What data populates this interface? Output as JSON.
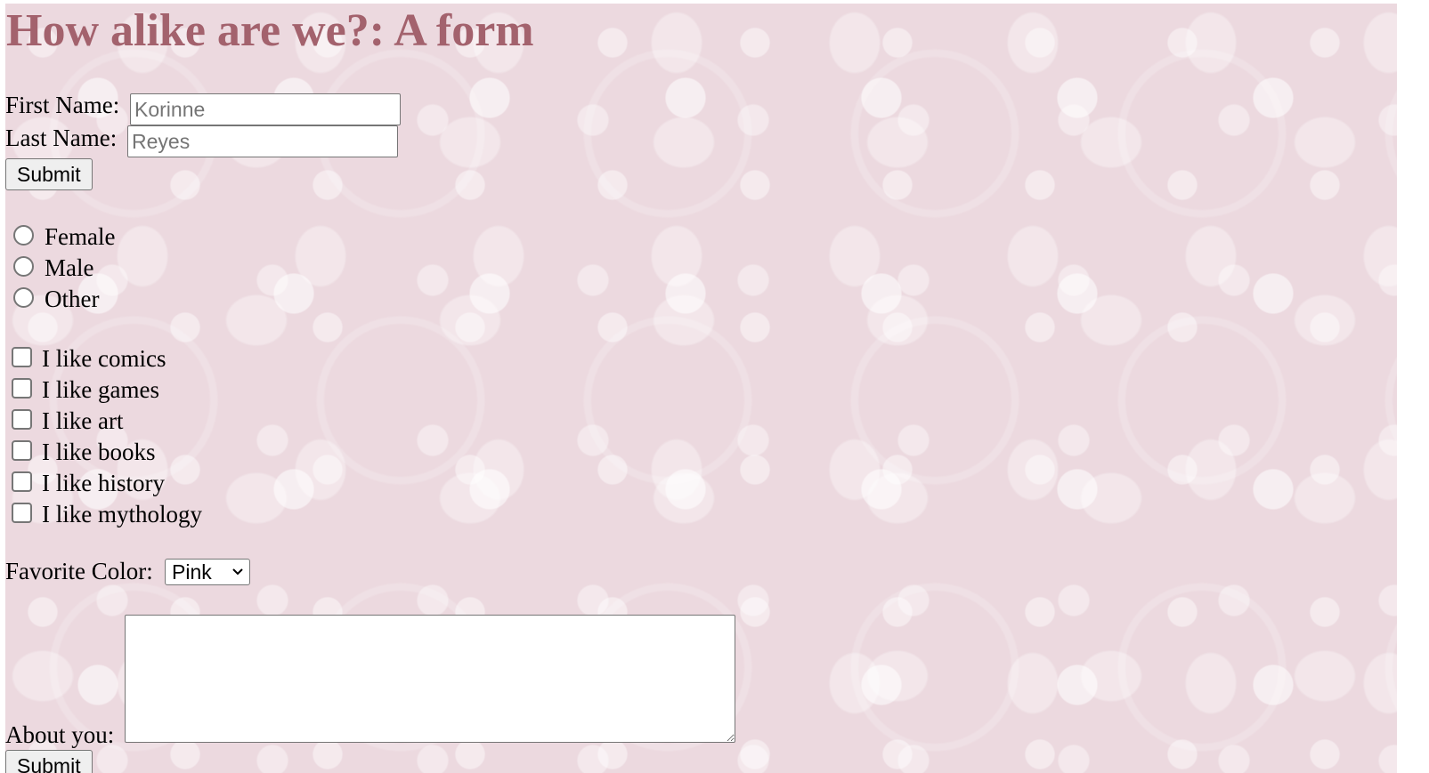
{
  "page": {
    "title": "How alike are we?: A form",
    "colors": {
      "title": "#a3626d",
      "background": "#ecd9df"
    }
  },
  "name_form": {
    "first_name_label": "First Name:",
    "first_name_value": "",
    "first_name_placeholder": "Korinne",
    "last_name_label": "Last Name:",
    "last_name_value": "",
    "last_name_placeholder": "Reyes",
    "submit_label": "Submit"
  },
  "gender": {
    "options": [
      {
        "label": "Female",
        "checked": false
      },
      {
        "label": "Male",
        "checked": false
      },
      {
        "label": "Other",
        "checked": false
      }
    ]
  },
  "interests": {
    "options": [
      {
        "label": "I like comics",
        "checked": false
      },
      {
        "label": "I like games",
        "checked": false
      },
      {
        "label": "I like art",
        "checked": false
      },
      {
        "label": "I like books",
        "checked": false
      },
      {
        "label": "I like history",
        "checked": false
      },
      {
        "label": "I like mythology",
        "checked": false
      }
    ]
  },
  "favorite_color": {
    "label": "Favorite Color:",
    "selected": "Pink",
    "icon": "chevron-down-icon"
  },
  "about": {
    "label": "About you:",
    "value": "",
    "submit_label": "Submit"
  }
}
